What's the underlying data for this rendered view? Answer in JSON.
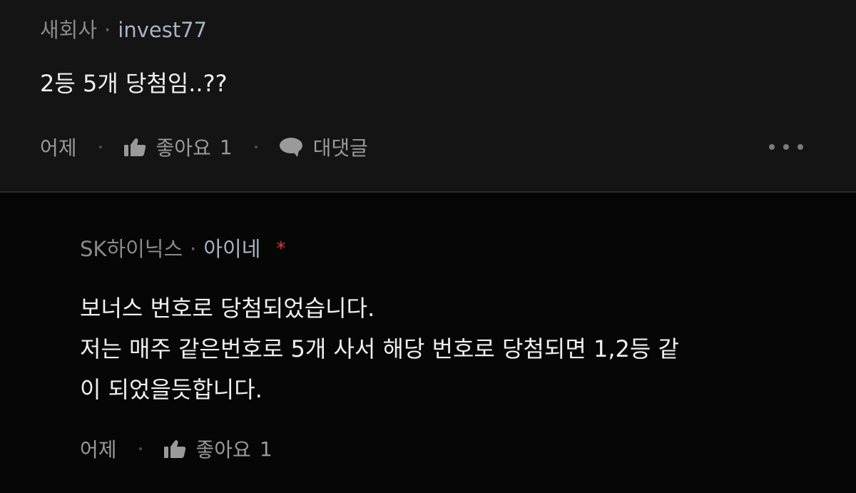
{
  "comment": {
    "company": "새회사",
    "separator": "·",
    "username": "invest77",
    "text": "2등 5개 당첨임..??",
    "time": "어제",
    "like_label": "좋아요",
    "like_count": "1",
    "reply_label": "대댓글",
    "icons": {
      "like": "thumbs-up-icon",
      "reply": "speech-bubble-icon",
      "more": "more-dots-icon"
    }
  },
  "reply": {
    "company": "SK하이닉스",
    "separator": "·",
    "username": "아이네",
    "marker": "*",
    "lines": [
      "보너스 번호로 당첨되었습니다.",
      "저는 매주 같은번호로 5개 사서 해당 번호로 당첨되면 1,2등 같",
      "이 되었을듯합니다."
    ],
    "time": "어제",
    "like_label": "좋아요",
    "like_count": "1"
  },
  "colors": {
    "background_top": "#141414",
    "background_reply": "#060606",
    "username": "#a8b3c6",
    "marker": "#e0353c"
  }
}
